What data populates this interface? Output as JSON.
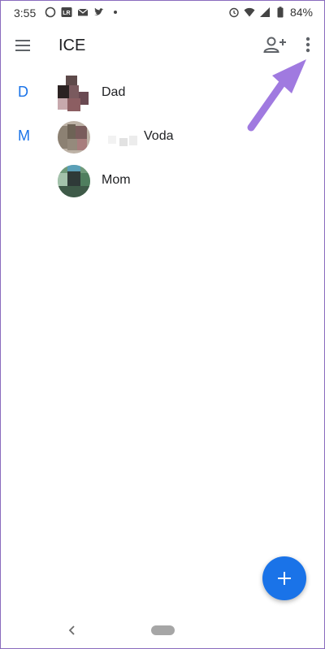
{
  "status_bar": {
    "time": "3:55",
    "battery_percent": "84%",
    "notification_icons": [
      "whatsapp-icon",
      "lr-icon",
      "mail-icon",
      "twitter-icon",
      "dot-icon"
    ],
    "system_icons": [
      "alarm-icon",
      "wifi-icon",
      "signal-icon",
      "battery-icon"
    ]
  },
  "app_bar": {
    "title": "ICE",
    "menu_icon": "hamburger-menu-icon",
    "add_contact_icon": "add-person-icon",
    "more_icon": "more-vert-icon"
  },
  "contacts": [
    {
      "section": "D",
      "name": "Dad"
    },
    {
      "section": "M",
      "name": "Voda"
    },
    {
      "section": "",
      "name": "Mom"
    }
  ],
  "fab": {
    "icon": "plus-icon"
  },
  "nav_bar": {
    "back_icon": "back-chevron-icon",
    "home_icon": "home-pill"
  },
  "colors": {
    "accent": "#1a73e8",
    "annotation_arrow": "#a07ae0",
    "text": "#202124"
  }
}
